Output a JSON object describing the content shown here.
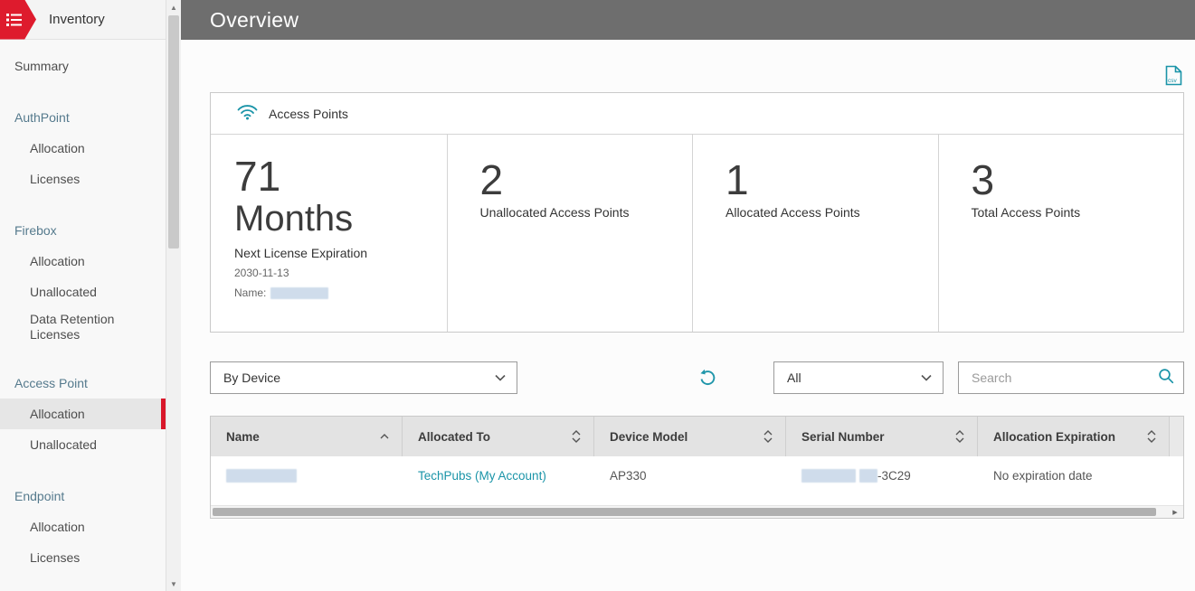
{
  "sidebar": {
    "title": "Inventory",
    "items": [
      {
        "label": "Summary"
      },
      {
        "label": "AuthPoint"
      },
      {
        "label": "Allocation"
      },
      {
        "label": "Licenses"
      },
      {
        "label": "Firebox"
      },
      {
        "label": "Allocation"
      },
      {
        "label": "Unallocated"
      },
      {
        "label": "Data Retention Licenses"
      },
      {
        "label": "Access Point"
      },
      {
        "label": "Allocation"
      },
      {
        "label": "Unallocated"
      },
      {
        "label": "Endpoint"
      },
      {
        "label": "Allocation"
      },
      {
        "label": "Licenses"
      }
    ]
  },
  "header": {
    "title": "Overview"
  },
  "card": {
    "title": "Access Points",
    "stat_primary": {
      "value": "71",
      "unit": "Months",
      "label": "Next License Expiration",
      "date": "2030-11-13",
      "name_label": "Name:"
    },
    "stats": [
      {
        "value": "2",
        "label": "Unallocated Access Points"
      },
      {
        "value": "1",
        "label": "Allocated Access Points"
      },
      {
        "value": "3",
        "label": "Total Access Points"
      }
    ]
  },
  "toolbar": {
    "group_by": "By Device",
    "filter": "All",
    "search_placeholder": "Search"
  },
  "table": {
    "columns": [
      "Name",
      "Allocated To",
      "Device Model",
      "Serial Number",
      "Allocation Expiration"
    ],
    "row": {
      "allocated_to": "TechPubs (My Account)",
      "device_model": "AP330",
      "serial_suffix": "-3C29",
      "expiration": "No expiration date"
    }
  },
  "colors": {
    "accent_red": "#de1b2d",
    "teal": "#1a94a8",
    "header_gray": "#6e6e6e"
  }
}
